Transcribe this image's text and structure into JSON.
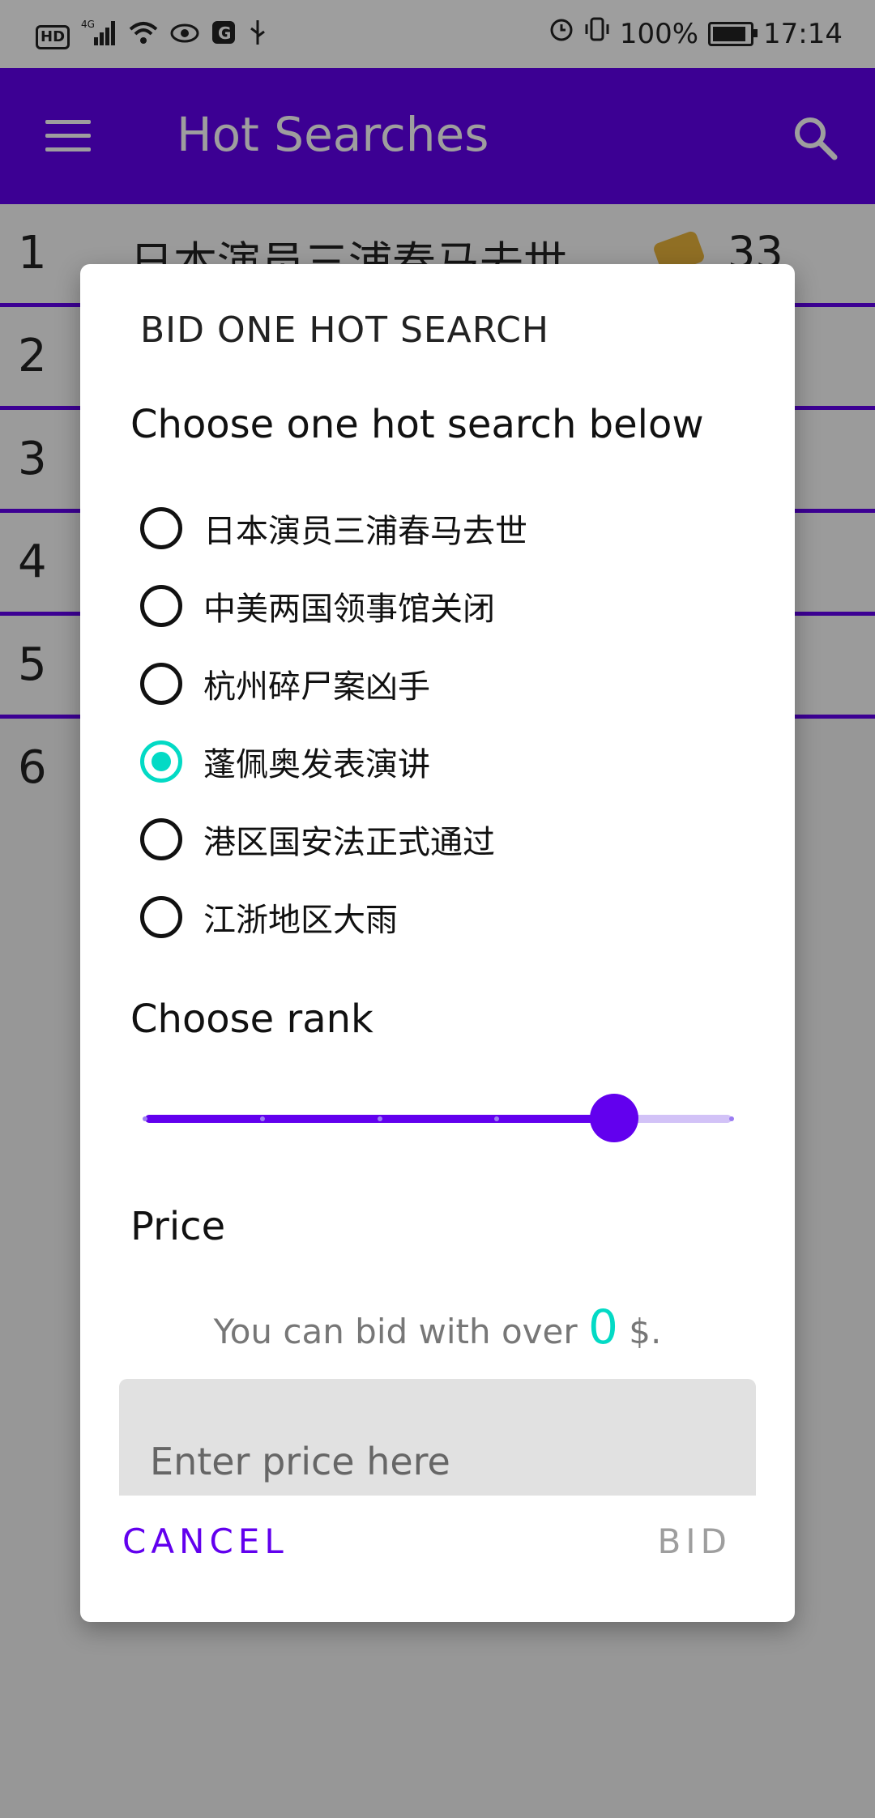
{
  "status_bar": {
    "hd": "HD",
    "network": "4G",
    "battery": "100%",
    "time": "17:14"
  },
  "app_bar": {
    "title": "Hot Searches"
  },
  "list": [
    {
      "rank": "1",
      "title": "日本演员三浦春马去世",
      "count": "33"
    },
    {
      "rank": "2",
      "title": "",
      "count": ""
    },
    {
      "rank": "3",
      "title": "",
      "count": ""
    },
    {
      "rank": "4",
      "title": "",
      "count": ""
    },
    {
      "rank": "5",
      "title": "",
      "count": ""
    },
    {
      "rank": "6",
      "title": "",
      "count": ""
    }
  ],
  "dialog": {
    "title": "BID ONE HOT SEARCH",
    "choose_label": "Choose one hot search below",
    "options": [
      {
        "label": "日本演员三浦春马去世",
        "checked": false
      },
      {
        "label": "中美两国领事馆关闭",
        "checked": false
      },
      {
        "label": "杭州碎尸案凶手",
        "checked": false
      },
      {
        "label": "蓬佩奥发表演讲",
        "checked": true
      },
      {
        "label": "港区国安法正式通过",
        "checked": false
      },
      {
        "label": "江浙地区大雨",
        "checked": false
      }
    ],
    "rank_label": "Choose rank",
    "rank_slider": {
      "min": 1,
      "max": 6,
      "value": 5
    },
    "price_label": "Price",
    "bid_prefix": "You can bid with over",
    "bid_value": "0",
    "bid_suffix": "$.",
    "price_placeholder": "Enter price here",
    "cancel_label": "CANCEL",
    "bid_label": "BID"
  },
  "colors": {
    "primary": "#6200ee",
    "accent": "#03dac5"
  }
}
